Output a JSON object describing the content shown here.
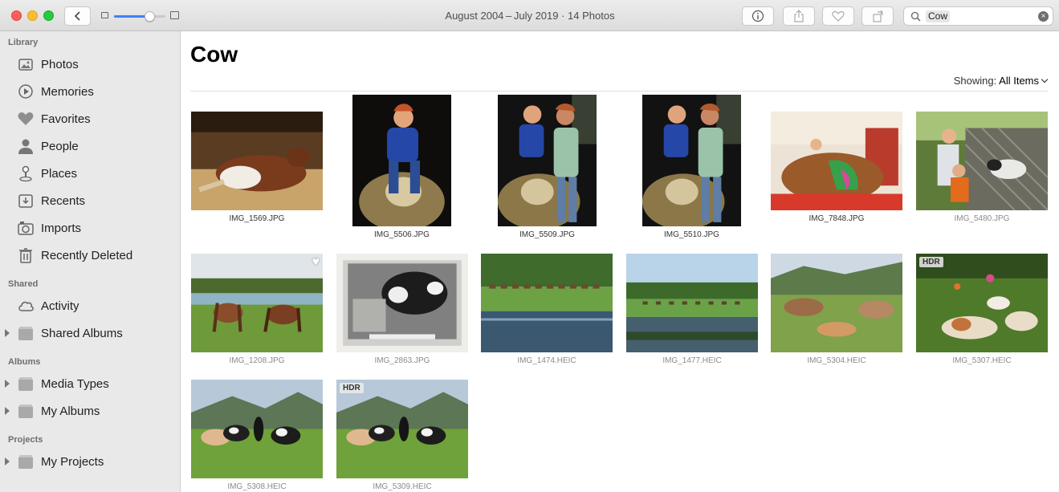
{
  "window": {
    "title": "August 2004 – July 2019 · 14 Photos"
  },
  "toolbar": {
    "zoom_level": 0.68,
    "search_token": "Cow"
  },
  "sidebar": {
    "sections": [
      {
        "label": "Library"
      },
      {
        "label": "Shared"
      },
      {
        "label": "Albums"
      },
      {
        "label": "Projects"
      }
    ],
    "items": [
      {
        "label": "Photos",
        "icon": "photos-icon"
      },
      {
        "label": "Memories",
        "icon": "memories-icon"
      },
      {
        "label": "Favorites",
        "icon": "heart-icon"
      },
      {
        "label": "People",
        "icon": "person-icon"
      },
      {
        "label": "Places",
        "icon": "pin-icon"
      },
      {
        "label": "Recents",
        "icon": "recents-icon"
      },
      {
        "label": "Imports",
        "icon": "camera-icon"
      },
      {
        "label": "Recently Deleted",
        "icon": "trash-icon"
      },
      {
        "label": "Activity",
        "icon": "cloud-icon"
      },
      {
        "label": "Shared Albums",
        "icon": "folder-icon"
      },
      {
        "label": "Media Types",
        "icon": "folder-icon"
      },
      {
        "label": "My Albums",
        "icon": "folder-icon"
      },
      {
        "label": "My Projects",
        "icon": "folder-icon"
      }
    ]
  },
  "main": {
    "title": "Cow",
    "showing_label": "Showing:",
    "showing_value": "All Items",
    "photos": [
      {
        "name": "IMG_1569.JPG",
        "scene": "barn-cow"
      },
      {
        "name": "IMG_5506.JPG",
        "scene": "pig-statue-boy"
      },
      {
        "name": "IMG_5509.JPG",
        "scene": "pig-statue-two"
      },
      {
        "name": "IMG_5510.JPG",
        "scene": "pig-statue-two"
      },
      {
        "name": "IMG_7848.JPG",
        "scene": "painted-cow"
      },
      {
        "name": "IMG_5480.JPG",
        "scene": "goats-fence"
      },
      {
        "name": "IMG_1208.JPG",
        "scene": "horses-pasture",
        "favorite": true
      },
      {
        "name": "IMG_2863.JPG",
        "scene": "bw-cow-photo"
      },
      {
        "name": "IMG_1474.HEIC",
        "scene": "pond-cows"
      },
      {
        "name": "IMG_1477.HEIC",
        "scene": "pond-cows-sky"
      },
      {
        "name": "IMG_5304.HEIC",
        "scene": "alpine-cows"
      },
      {
        "name": "IMG_5307.HEIC",
        "scene": "lying-cows",
        "hdr": "HDR"
      },
      {
        "name": "IMG_5308.HEIC",
        "scene": "mountain-cows"
      },
      {
        "name": "IMG_5309.HEIC",
        "scene": "mountain-cows",
        "hdr": "HDR"
      }
    ]
  }
}
